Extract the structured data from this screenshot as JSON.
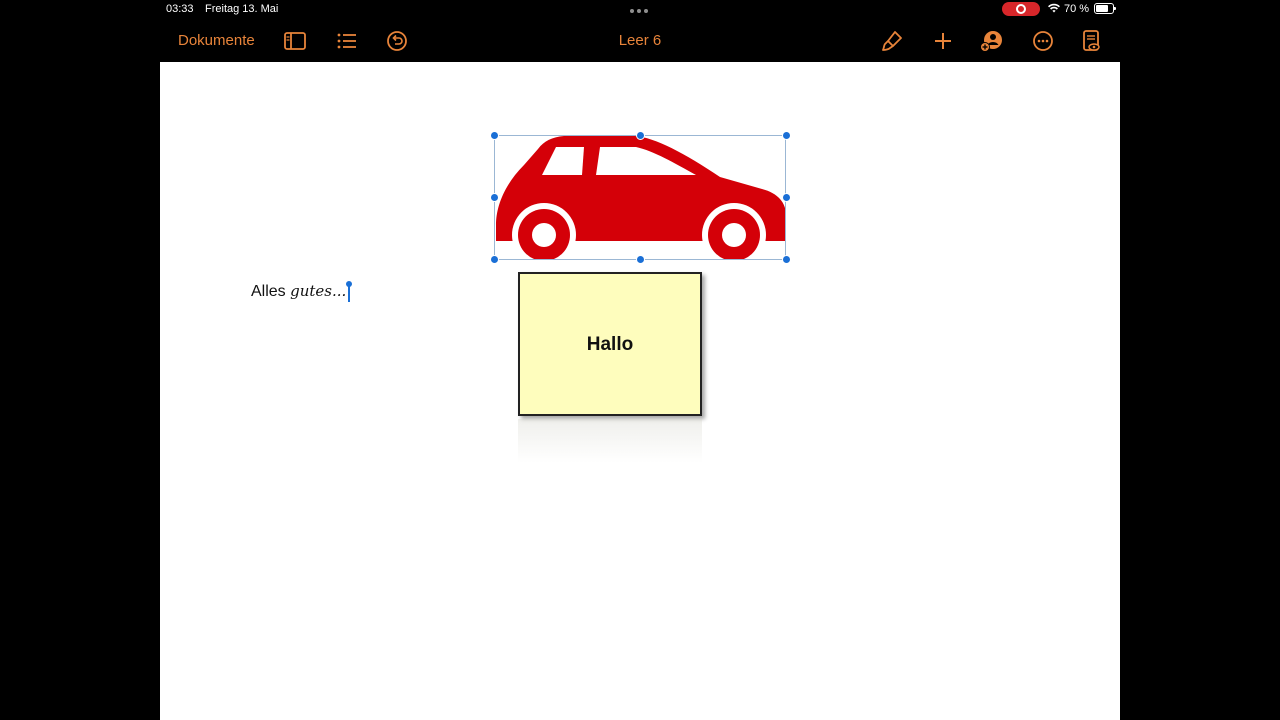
{
  "status_bar": {
    "time": "03:33",
    "date": "Freitag 13. Mai",
    "battery": "70 %"
  },
  "toolbar": {
    "documents_label": "Dokumente",
    "title": "Leer 6",
    "icons": [
      "sidebar-icon",
      "list-icon",
      "undo-icon",
      "paintbrush-icon",
      "plus-icon",
      "collaborate-icon",
      "more-icon",
      "document-view-icon"
    ],
    "accent_color": "#e8843a"
  },
  "document": {
    "text_line_word1": "Alles",
    "text_line_word2": "gutes...",
    "note_label": "Hallo",
    "car_color": "#d40008",
    "note_color": "#fefdbd"
  }
}
